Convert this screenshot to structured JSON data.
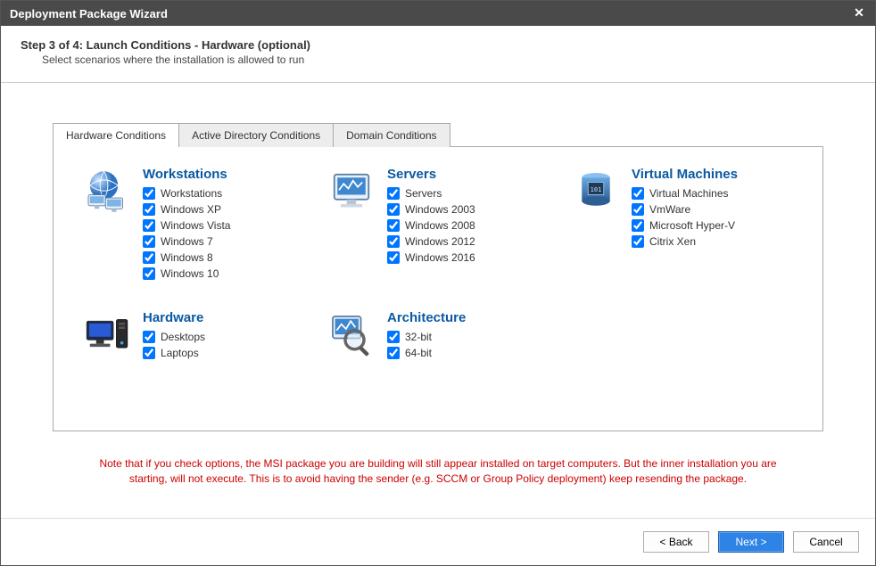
{
  "window": {
    "title": "Deployment Package Wizard"
  },
  "step": {
    "title": "Step 3 of 4: Launch Conditions - Hardware (optional)",
    "subtitle": "Select scenarios where the installation is allowed to run"
  },
  "tabs": [
    {
      "label": "Hardware Conditions"
    },
    {
      "label": "Active Directory Conditions"
    },
    {
      "label": "Domain Conditions"
    }
  ],
  "categories": [
    {
      "name": "workstations",
      "title": "Workstations",
      "icon": "globe-monitors-icon",
      "items": [
        {
          "label": "Workstations",
          "checked": true
        },
        {
          "label": "Windows XP",
          "checked": true
        },
        {
          "label": "Windows Vista",
          "checked": true
        },
        {
          "label": "Windows 7",
          "checked": true
        },
        {
          "label": "Windows 8",
          "checked": true
        },
        {
          "label": "Windows 10",
          "checked": true
        }
      ]
    },
    {
      "name": "servers",
      "title": "Servers",
      "icon": "server-monitor-icon",
      "items": [
        {
          "label": "Servers",
          "checked": true
        },
        {
          "label": "Windows 2003",
          "checked": true
        },
        {
          "label": "Windows 2008",
          "checked": true
        },
        {
          "label": "Windows 2012",
          "checked": true
        },
        {
          "label": "Windows 2016",
          "checked": true
        }
      ]
    },
    {
      "name": "virtual-machines",
      "title": "Virtual Machines",
      "icon": "vm-chip-icon",
      "items": [
        {
          "label": "Virtual Machines",
          "checked": true
        },
        {
          "label": "VmWare",
          "checked": true
        },
        {
          "label": "Microsoft Hyper-V",
          "checked": true
        },
        {
          "label": "Citrix Xen",
          "checked": true
        }
      ]
    },
    {
      "name": "hardware",
      "title": "Hardware",
      "icon": "desktop-tower-icon",
      "items": [
        {
          "label": "Desktops",
          "checked": true
        },
        {
          "label": "Laptops",
          "checked": true
        }
      ]
    },
    {
      "name": "architecture",
      "title": "Architecture",
      "icon": "magnifier-chart-icon",
      "items": [
        {
          "label": "32-bit",
          "checked": true
        },
        {
          "label": "64-bit",
          "checked": true
        }
      ]
    }
  ],
  "note": "Note that if you check options, the MSI package you are building will still appear installed on target computers. But the inner installation you are starting, will not execute. This is to avoid having the sender (e.g. SCCM or Group Policy deployment) keep resending the package.",
  "buttons": {
    "back": "< Back",
    "next": "Next >",
    "cancel": "Cancel"
  }
}
